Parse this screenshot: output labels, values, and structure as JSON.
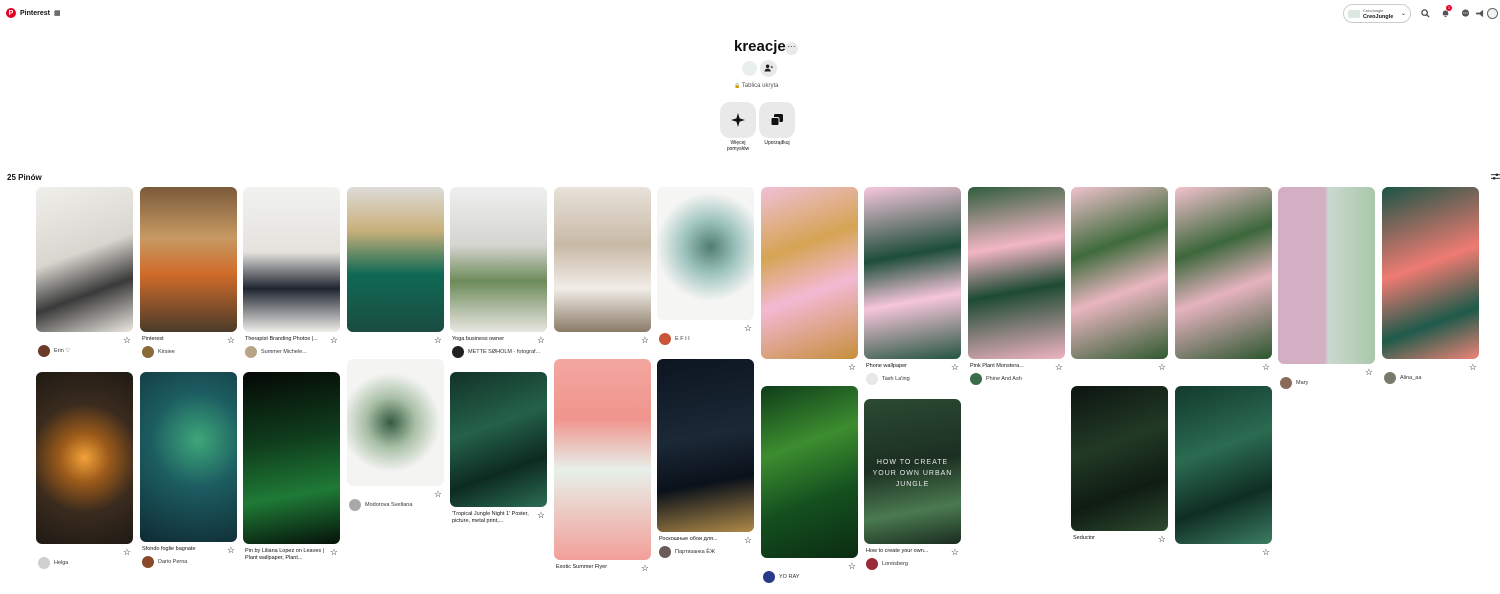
{
  "header": {
    "brand": "Pinterest",
    "menu_glyph": "▦",
    "account_small": "CreoJungle",
    "account_name": "CreoJungle",
    "notif_count": "1",
    "icons": [
      "search-icon",
      "bell-icon",
      "chat-icon",
      "megaphone-icon",
      "avatar"
    ]
  },
  "board": {
    "title": "kreacje",
    "more_glyph": "···",
    "status": "Tablica ukryta",
    "lock_glyph": "🔒",
    "actions": [
      {
        "label": "Więcej pomysłów",
        "icon": "sparkle-icon",
        "glyph": "✦"
      },
      {
        "label": "Uporządkuj",
        "icon": "organize-icon",
        "glyph": "❐"
      }
    ]
  },
  "pins_header": {
    "count_label": "25 Pinów"
  },
  "colors": {
    "brand": "#e60023"
  },
  "pins": [
    {
      "title": "",
      "user": "Erin ♡"
    },
    {
      "title": "Pinterest",
      "user": "Kirsiee"
    },
    {
      "title": "Therapist Branding Photos |...",
      "user": "Summer Michele..."
    },
    {
      "title": "",
      "user": ""
    },
    {
      "title": "Yoga business owner",
      "user": "METTE SØHOLM - fotograf..."
    },
    {
      "title": "",
      "user": ""
    },
    {
      "title": "",
      "user": "E F I I"
    },
    {
      "title": "",
      "user": ""
    },
    {
      "title": "Phone wallpaper",
      "user": "Tash La'ing"
    },
    {
      "title": "Pink Plant Monstera...",
      "user": "Phine And Ash"
    },
    {
      "title": "",
      "user": ""
    },
    {
      "title": "",
      "user": ""
    },
    {
      "title": "",
      "user": "Mary"
    },
    {
      "title": "",
      "user": "Alina_aa"
    },
    {
      "title": "",
      "user": "Helga"
    },
    {
      "title": "Sfondo foglie bagnate",
      "user": "Dario Perna"
    },
    {
      "title": "Pin by Liliana Lopez on Leaves | Plant wallpaper, Plant...",
      "user": ""
    },
    {
      "title": "",
      "user": "Modorova Svetlana"
    },
    {
      "title": "'Tropical Jungle Night 1' Poster, picture, metal print,...",
      "user": ""
    },
    {
      "title": "Exotic Summer Flyer",
      "user": ""
    },
    {
      "title": "Роскошные обои для...",
      "user": "Партизанка ЁЖ"
    },
    {
      "title": "",
      "user": "YO RAY"
    },
    {
      "title": "How to create your own...",
      "user": "Loreisberg",
      "overlay": "HOW TO CREATE YOUR OWN URBAN JUNGLE"
    },
    {
      "title": "Seductor",
      "user": ""
    },
    {
      "title": "",
      "user": ""
    }
  ]
}
